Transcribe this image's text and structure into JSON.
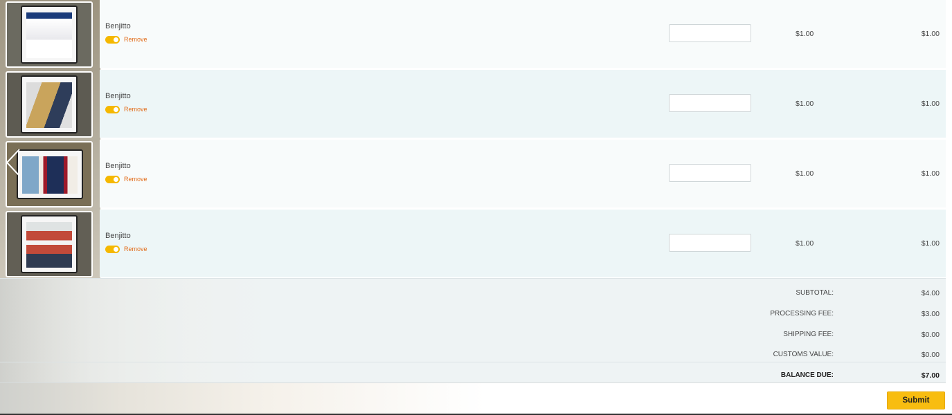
{
  "items": [
    {
      "seller": "Benjitto",
      "remove_label": "Remove",
      "quantity": "",
      "price": "$1.00",
      "total": "$1.00",
      "thumb_colors": [
        "#d9dce4",
        "#1a3b7a",
        "#c9a48a"
      ]
    },
    {
      "seller": "Benjitto",
      "remove_label": "Remove",
      "quantity": "",
      "price": "$1.00",
      "total": "$1.00",
      "thumb_colors": [
        "#cfd0d4",
        "#c9a45c",
        "#2e3d5a"
      ]
    },
    {
      "seller": "Benjitto",
      "remove_label": "Remove",
      "quantity": "",
      "price": "$1.00",
      "total": "$1.00",
      "thumb_colors": [
        "#d7c9b0",
        "#9e1a2a",
        "#1e2f58"
      ]
    },
    {
      "seller": "Benjitto",
      "remove_label": "Remove",
      "quantity": "",
      "price": "$1.00",
      "total": "$1.00",
      "thumb_colors": [
        "#d3d6d6",
        "#c24a3a",
        "#2f3b52"
      ]
    }
  ],
  "summary": {
    "subtotal_label": "SUBTOTAL:",
    "subtotal_value": "$4.00",
    "processing_label": "PROCESSING FEE:",
    "processing_value": "$3.00",
    "shipping_label": "SHIPPING FEE:",
    "shipping_value": "$0.00",
    "customs_label": "CUSTOMS VALUE:",
    "customs_value": "$0.00",
    "balance_label": "BALANCE DUE:",
    "balance_value": "$7.00"
  },
  "submit_label": "Submit",
  "colors": {
    "accent": "#f8bd10",
    "remove_link": "#e26b18",
    "row_odd": "#f8fbfb",
    "row_even": "#edf6f7"
  },
  "icons": {
    "carousel_prev": "chevron-left-icon",
    "toggle": "toggle-switch-icon"
  }
}
